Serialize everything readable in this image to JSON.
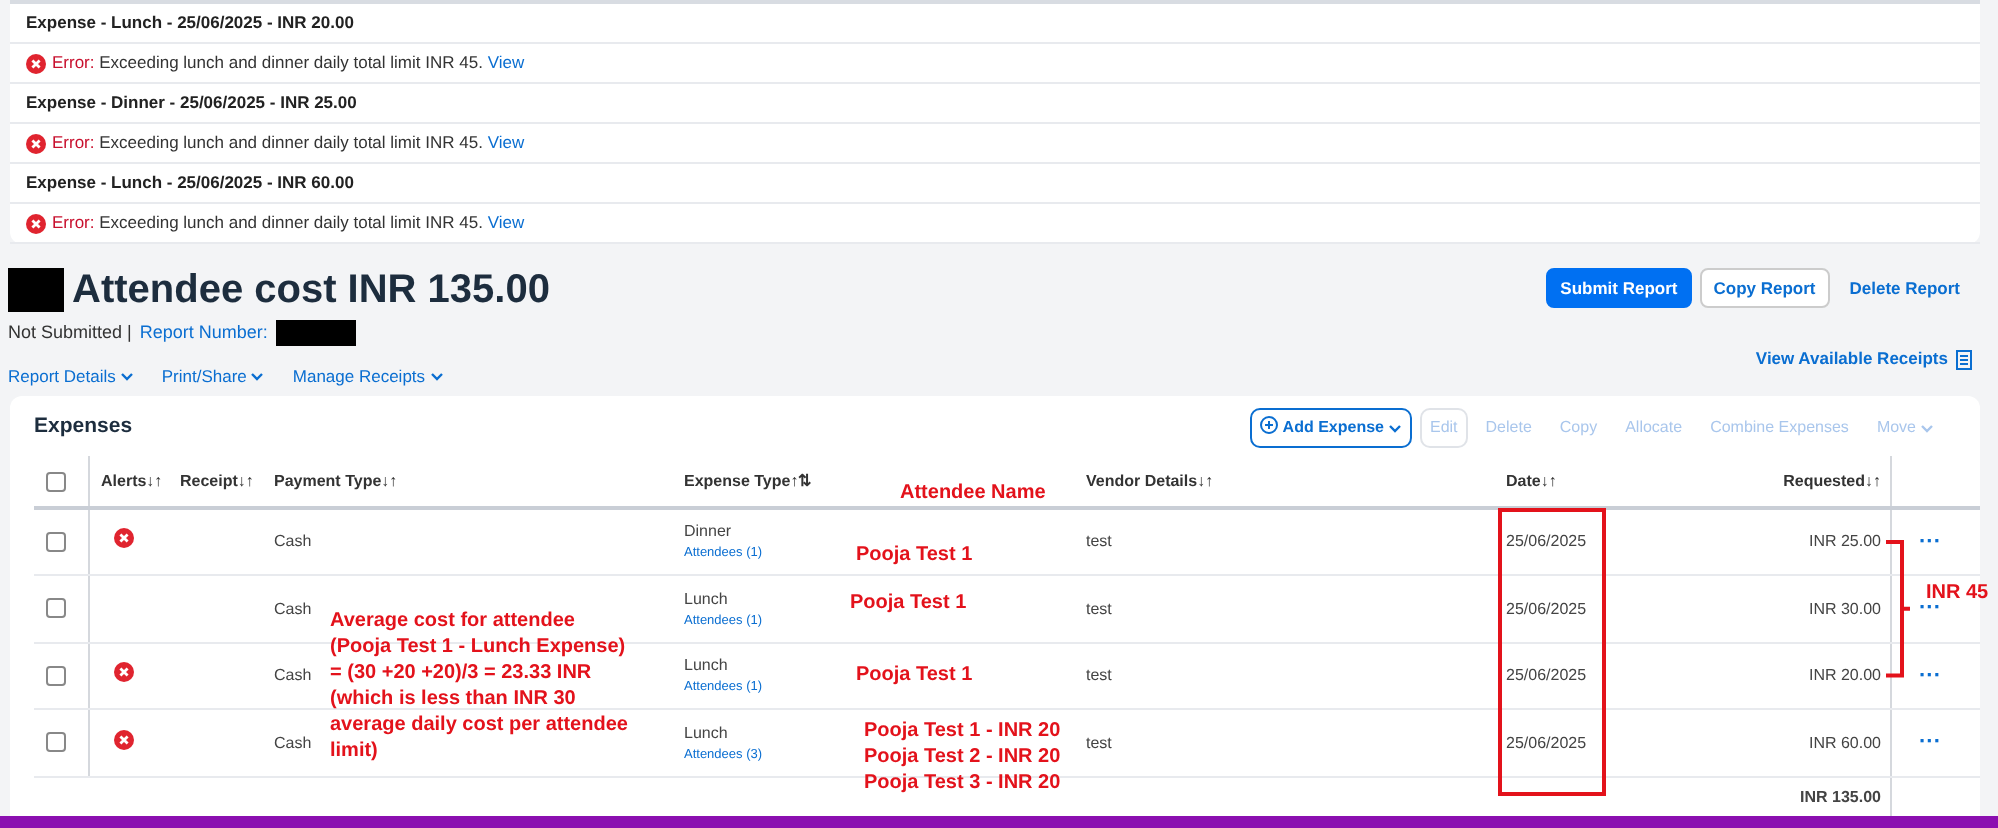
{
  "alerts": [
    {
      "title": "Expense - Lunch - 25/06/2025 - INR 20.00",
      "label": "Error:",
      "message": "Exceeding lunch and dinner daily total limit INR 45.",
      "link": "View"
    },
    {
      "title": "Expense - Dinner - 25/06/2025 - INR 25.00",
      "label": "Error:",
      "message": "Exceeding lunch and dinner daily total limit INR 45.",
      "link": "View"
    },
    {
      "title": "Expense - Lunch - 25/06/2025 - INR 60.00",
      "label": "Error:",
      "message": "Exceeding lunch and dinner daily total limit INR 45.",
      "link": "View"
    }
  ],
  "report": {
    "title": "Attendee cost INR 135.00",
    "status": "Not Submitted |",
    "number_label": "Report Number:",
    "actions": [
      {
        "label": "Submit Report",
        "kind": "primary"
      },
      {
        "label": "Copy Report",
        "kind": "outline"
      },
      {
        "label": "Delete Report",
        "kind": "link"
      }
    ],
    "menus": [
      "Report Details",
      "Print/Share",
      "Manage Receipts"
    ],
    "receipts_link": "View Available Receipts"
  },
  "expenses": {
    "title": "Expenses",
    "toolbar": [
      {
        "label": "Add Expense",
        "kind": "add",
        "disabled": false
      },
      {
        "label": "Edit",
        "kind": "boxed",
        "disabled": true
      },
      {
        "label": "Delete",
        "kind": "plain",
        "disabled": true
      },
      {
        "label": "Copy",
        "kind": "plain",
        "disabled": true
      },
      {
        "label": "Allocate",
        "kind": "plain",
        "disabled": true
      },
      {
        "label": "Combine Expenses",
        "kind": "plain",
        "disabled": true
      },
      {
        "label": "Move",
        "kind": "menu",
        "disabled": true
      }
    ],
    "select_all_checked": false,
    "columns": [
      "Alerts↓↑",
      "Receipt↓↑",
      "Payment Type↓↑",
      "Expense Type↑⇅",
      "Vendor Details↓↑",
      "Date↓↑",
      "Requested↓↑"
    ],
    "rows": [
      {
        "checked": false,
        "alert": true,
        "payment": "Cash",
        "type": "Dinner",
        "attendees": "Attendees (1)",
        "vendor": "test",
        "date": "25/06/2025",
        "amount": "INR 25.00",
        "menu": "···"
      },
      {
        "checked": false,
        "alert": false,
        "payment": "Cash",
        "type": "Lunch",
        "attendees": "Attendees (1)",
        "vendor": "test",
        "date": "25/06/2025",
        "amount": "INR 30.00",
        "menu": "···"
      },
      {
        "checked": false,
        "alert": true,
        "payment": "Cash",
        "type": "Lunch",
        "attendees": "Attendees (1)",
        "vendor": "test",
        "date": "25/06/2025",
        "amount": "INR 20.00",
        "menu": "···"
      },
      {
        "checked": false,
        "alert": true,
        "payment": "Cash",
        "type": "Lunch",
        "attendees": "Attendees (3)",
        "vendor": "test",
        "date": "25/06/2025",
        "amount": "INR 60.00",
        "menu": "···"
      }
    ],
    "total": "INR 135.00"
  },
  "annotations": {
    "column_title": "Attendee Name",
    "row_names": [
      [
        "Pooja Test 1"
      ],
      [
        "Pooja Test 1"
      ],
      [
        "Pooja Test 1"
      ],
      [
        "Pooja Test 1 - INR 20",
        "Pooja Test 2 - INR 20",
        "Pooja Test 3 - INR 20"
      ]
    ],
    "note": [
      "Average cost for attendee",
      "(Pooja Test 1 - Lunch Expense)",
      "= (30 +20 +20)/3 = 23.33 INR",
      "(which is less than INR 30",
      "average daily cost per attendee",
      "limit)"
    ],
    "bracket_label": "INR 45"
  }
}
